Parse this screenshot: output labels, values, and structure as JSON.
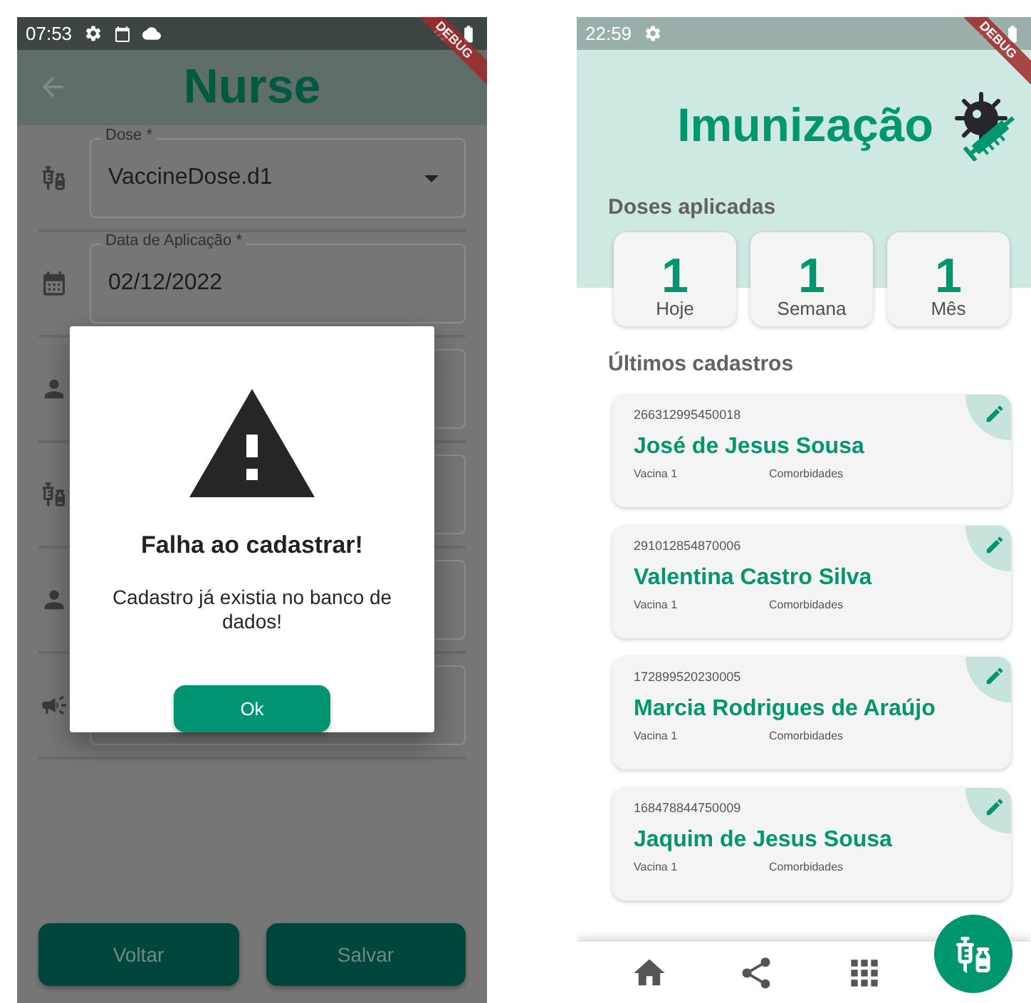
{
  "nurse_screen": {
    "status_bar": {
      "time": "07:53"
    },
    "debug_banner": "DEBUG",
    "app_bar": {
      "title": "Nurse"
    },
    "form_fields": [
      {
        "kind": "dropdown",
        "label": "Dose *",
        "value": "VaccineDose.d1"
      },
      {
        "kind": "date",
        "label": "Data de Aplicação *",
        "value": "02/12/2022"
      },
      {
        "kind": "text"
      },
      {
        "kind": "text"
      },
      {
        "kind": "text"
      },
      {
        "kind": "text"
      }
    ],
    "dialog": {
      "title": "Falha ao cadastrar!",
      "message": "Cadastro já existia no banco de dados!",
      "button": "Ok"
    },
    "buttons": [
      "Voltar",
      "Salvar"
    ]
  },
  "immunization_screen": {
    "status_bar": {
      "time": "22:59"
    },
    "debug_banner": "DEBUG",
    "title": "Imunização",
    "doses": {
      "heading": "Doses aplicadas",
      "stats": [
        {
          "value": "1",
          "label": "Hoje"
        },
        {
          "value": "1",
          "label": "Semana"
        },
        {
          "value": "1",
          "label": "Mês"
        }
      ]
    },
    "recent": {
      "heading": "Últimos cadastros",
      "records": [
        {
          "id": "266312995450018",
          "name": "José de Jesus Sousa",
          "vaccine": "Vacina 1",
          "comorbidities": "Comorbidades"
        },
        {
          "id": "291012854870006",
          "name": "Valentina Castro Silva",
          "vaccine": "Vacina 1",
          "comorbidities": "Comorbidades"
        },
        {
          "id": "172899520230005",
          "name": "Marcia Rodrigues de Araújo",
          "vaccine": "Vacina 1",
          "comorbidities": "Comorbidades"
        },
        {
          "id": "168478844750009",
          "name": "Jaquim de Jesus Sousa",
          "vaccine": "Vacina 1",
          "comorbidities": "Comorbidades"
        }
      ]
    }
  }
}
